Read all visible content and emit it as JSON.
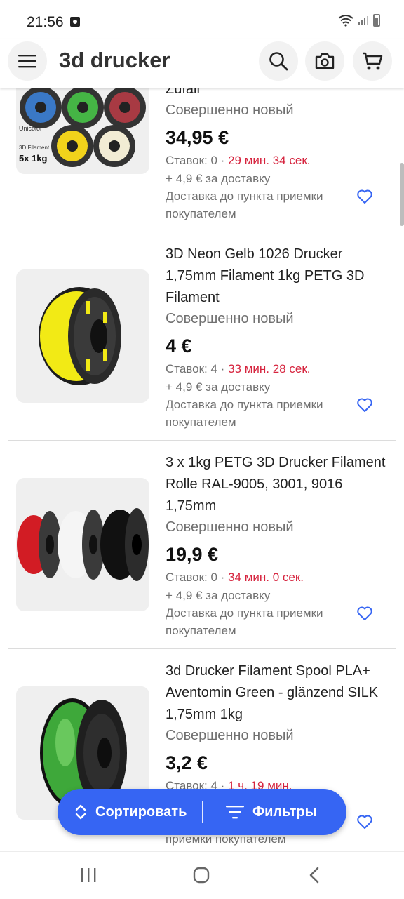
{
  "status_bar": {
    "time": "21:56"
  },
  "header": {
    "title": "3d drucker"
  },
  "items": [
    {
      "title": "Zufall",
      "condition": "Совершенно новый",
      "price": "34,95 €",
      "bids_prefix": "Ставок: 0 · ",
      "time_left": "29 мин. 34 сек.",
      "shipping": "+ 4,9 € за доставку",
      "delivery": "Доставка до пункта приемки покупателем",
      "image_text": [
        "Unicolor",
        "3D Filament",
        "5x 1kg"
      ]
    },
    {
      "title": "3D Neon Gelb 1026 Drucker 1,75mm Filament 1kg PETG 3D Filament",
      "condition": "Совершенно новый",
      "price": "4 €",
      "bids_prefix": "Ставок: 4 · ",
      "time_left": "33 мин. 28 сек.",
      "shipping": "+ 4,9 € за доставку",
      "delivery": "Доставка до пункта приемки покупателем"
    },
    {
      "title": "3 x 1kg  PETG 3D Drucker Filament Rolle RAL-9005, 3001, 9016 1,75mm",
      "condition": "Совершенно новый",
      "price": "19,9 €",
      "bids_prefix": "Ставок: 0 · ",
      "time_left": "34 мин. 0 сек.",
      "shipping": "+ 4,9 € за доставку",
      "delivery": "Доставка до пункта приемки покупателем"
    },
    {
      "title": "3d Drucker Filament Spool PLA+ Aventomin Green - glänzend SILK 1,75mm 1kg",
      "condition": "Совершенно новый",
      "price": "3,2 €",
      "bids_prefix": "Ставок: 4 · ",
      "time_left": "1 ч. 19 мин.",
      "shipping": "",
      "delivery": "приемки покупателем"
    }
  ],
  "actions": {
    "sort_label": "Сортировать",
    "filter_label": "Фильтры"
  },
  "colors": {
    "accent": "#3665f3",
    "time_red": "#d6243e",
    "muted": "#707070"
  }
}
